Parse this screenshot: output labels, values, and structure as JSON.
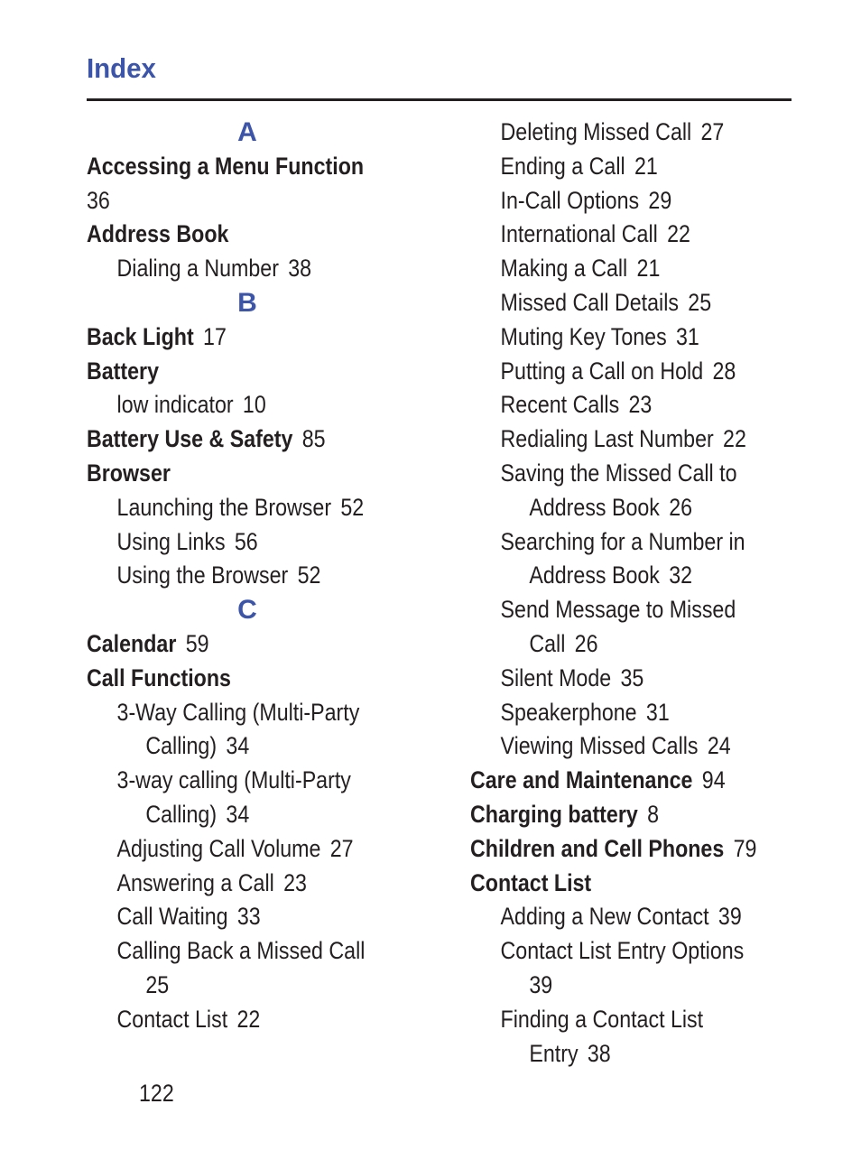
{
  "page": {
    "title": "Index",
    "page_number": "122",
    "accent_color": "#3d55a8"
  },
  "left_column": [
    {
      "type": "letter",
      "text": "A"
    },
    {
      "type": "main",
      "text": "Accessing a Menu Function"
    },
    {
      "type": "cont_flush",
      "text": "",
      "page": "36"
    },
    {
      "type": "main",
      "text": "Address Book"
    },
    {
      "type": "sub",
      "text": "Dialing a Number",
      "page": "38"
    },
    {
      "type": "letter",
      "text": "B"
    },
    {
      "type": "main",
      "text": "Back Light",
      "page": "17"
    },
    {
      "type": "main",
      "text": "Battery"
    },
    {
      "type": "sub",
      "text": "low indicator",
      "page": "10"
    },
    {
      "type": "main",
      "text": "Battery Use & Safety",
      "page": "85"
    },
    {
      "type": "main",
      "text": "Browser"
    },
    {
      "type": "sub",
      "text": "Launching the Browser",
      "page": "52"
    },
    {
      "type": "sub",
      "text": "Using Links",
      "page": "56"
    },
    {
      "type": "sub",
      "text": "Using the Browser",
      "page": "52"
    },
    {
      "type": "letter",
      "text": "C"
    },
    {
      "type": "main",
      "text": "Calendar",
      "page": "59"
    },
    {
      "type": "main",
      "text": "Call Functions"
    },
    {
      "type": "sub",
      "text": "3-Way Calling (Multi-Party"
    },
    {
      "type": "cont",
      "text": "Calling)",
      "page": "34"
    },
    {
      "type": "sub",
      "text": "3-way calling (Multi-Party"
    },
    {
      "type": "cont",
      "text": "Calling)",
      "page": "34"
    },
    {
      "type": "sub",
      "text": "Adjusting Call Volume",
      "page": "27"
    },
    {
      "type": "sub",
      "text": "Answering a Call",
      "page": "23"
    },
    {
      "type": "sub",
      "text": "Call Waiting",
      "page": "33"
    },
    {
      "type": "sub",
      "text": "Calling Back a Missed Call"
    },
    {
      "type": "cont",
      "text": "",
      "page": "25"
    },
    {
      "type": "sub",
      "text": "Contact List",
      "page": "22"
    }
  ],
  "right_column": [
    {
      "type": "sub",
      "text": "Deleting Missed Call",
      "page": "27"
    },
    {
      "type": "sub",
      "text": "Ending a Call",
      "page": "21"
    },
    {
      "type": "sub",
      "text": "In-Call Options",
      "page": "29"
    },
    {
      "type": "sub",
      "text": "International Call",
      "page": "22"
    },
    {
      "type": "sub",
      "text": "Making a Call",
      "page": "21"
    },
    {
      "type": "sub",
      "text": "Missed Call Details",
      "page": "25"
    },
    {
      "type": "sub",
      "text": "Muting Key Tones",
      "page": "31"
    },
    {
      "type": "sub",
      "text": "Putting a Call on Hold",
      "page": "28"
    },
    {
      "type": "sub",
      "text": "Recent Calls",
      "page": "23"
    },
    {
      "type": "sub",
      "text": "Redialing Last Number",
      "page": "22"
    },
    {
      "type": "sub",
      "text": "Saving the Missed Call to"
    },
    {
      "type": "cont",
      "text": "Address Book",
      "page": "26"
    },
    {
      "type": "sub",
      "text": "Searching for a Number in"
    },
    {
      "type": "cont",
      "text": "Address Book",
      "page": "32"
    },
    {
      "type": "sub",
      "text": "Send Message to Missed"
    },
    {
      "type": "cont",
      "text": "Call",
      "page": "26"
    },
    {
      "type": "sub",
      "text": "Silent Mode",
      "page": "35"
    },
    {
      "type": "sub",
      "text": "Speakerphone",
      "page": "31"
    },
    {
      "type": "sub",
      "text": "Viewing Missed Calls",
      "page": "24"
    },
    {
      "type": "main",
      "text": "Care and Maintenance",
      "page": "94"
    },
    {
      "type": "main",
      "text": "Charging battery",
      "page": "8"
    },
    {
      "type": "main",
      "text": "Children and Cell Phones",
      "page": "79"
    },
    {
      "type": "main",
      "text": "Contact List"
    },
    {
      "type": "sub",
      "text": "Adding a New Contact",
      "page": "39"
    },
    {
      "type": "sub",
      "text": "Contact List Entry Options"
    },
    {
      "type": "cont",
      "text": "",
      "page": "39"
    },
    {
      "type": "sub",
      "text": "Finding a Contact List"
    },
    {
      "type": "cont",
      "text": "Entry",
      "page": "38"
    }
  ]
}
